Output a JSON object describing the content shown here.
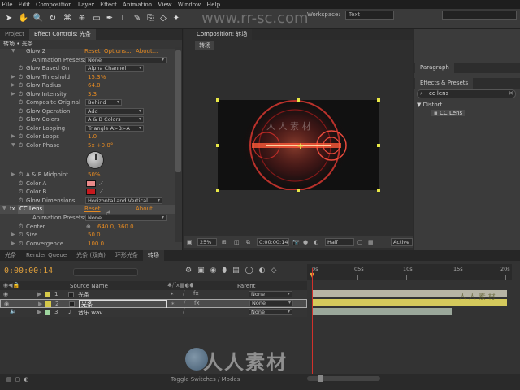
{
  "menu": [
    "File",
    "Edit",
    "Composition",
    "Layer",
    "Effect",
    "Animation",
    "View",
    "Window",
    "Help"
  ],
  "toolbar": {
    "workspace_label": "Workspace:",
    "workspace_value": "Text",
    "watermark": "www.rr-sc.com"
  },
  "left_panel": {
    "tabs": [
      "Project",
      "Effect Controls: 光条"
    ],
    "subheader": "转场 • 光条",
    "top_effect_label": "Glow 2",
    "top_effect_links": [
      "Reset",
      "Options...",
      "About..."
    ],
    "rows": [
      {
        "label": "Animation Presets:",
        "value": "None"
      },
      {
        "label": "Glow Based On",
        "value": "Alpha Channel"
      },
      {
        "label": "Glow Threshold",
        "value": "15.3%"
      },
      {
        "label": "Glow Radius",
        "value": "64.0"
      },
      {
        "label": "Glow Intensity",
        "value": "3.3"
      },
      {
        "label": "Composite Original",
        "value": "Behind"
      },
      {
        "label": "Glow Operation",
        "value": "Add"
      },
      {
        "label": "Glow Colors",
        "value": "A & B Colors"
      },
      {
        "label": "Color Looping",
        "value": "Triangle A>B>A"
      },
      {
        "label": "Color Loops",
        "value": "1.0"
      },
      {
        "label": "Color Phase",
        "value": "5x +0.0°"
      },
      {
        "label": "A & B Midpoint",
        "value": "50%"
      },
      {
        "label": "Color A",
        "value": ""
      },
      {
        "label": "Color B",
        "value": ""
      },
      {
        "label": "Glow Dimensions",
        "value": "Horizontal and Vertical"
      }
    ],
    "cc_lens": {
      "name": "CC Lens",
      "reset": "Reset",
      "about": "About..."
    },
    "lens_rows": [
      {
        "label": "Animation Presets:",
        "value": "None"
      },
      {
        "label": "Center",
        "value": "640.0, 360.0"
      },
      {
        "label": "Size",
        "value": "50.0"
      },
      {
        "label": "Convergence",
        "value": "100.0"
      }
    ],
    "colors": {
      "color_a": "#e98a8a",
      "color_b": "#c7191e"
    }
  },
  "comp_panel": {
    "tab": "Composition: 转场",
    "subtab": "转场",
    "overlay_text": "人 人 素 材",
    "zoom": "25%",
    "timecode": "0:00:00:14",
    "resolution": "Half",
    "active": "Active"
  },
  "right_panel": {
    "info_tab": "Paragraph",
    "effects_tab": "Effects & Presets",
    "search_value": "cc lens",
    "category": "Distort",
    "item": "CC Lens"
  },
  "timeline": {
    "tabs": [
      "光条",
      "Render Queue",
      "光条 (双向)",
      "环形光条",
      "转场"
    ],
    "current_time": "0:00:00:14",
    "header_source": "Source Name",
    "header_parent": "Parent",
    "ruler_labels": [
      "0s",
      "05s",
      "10s",
      "15s",
      "20s"
    ],
    "layers": [
      {
        "index": "1",
        "name": "光条",
        "parent": "None"
      },
      {
        "index": "2",
        "name": "光条",
        "parent": "None"
      },
      {
        "index": "3",
        "name": "音乐.wav",
        "parent": "None"
      }
    ],
    "bar_text": "人 人 素 材",
    "footer_label": "Toggle Switches / Modes"
  },
  "bottom_watermark": "人人素材"
}
